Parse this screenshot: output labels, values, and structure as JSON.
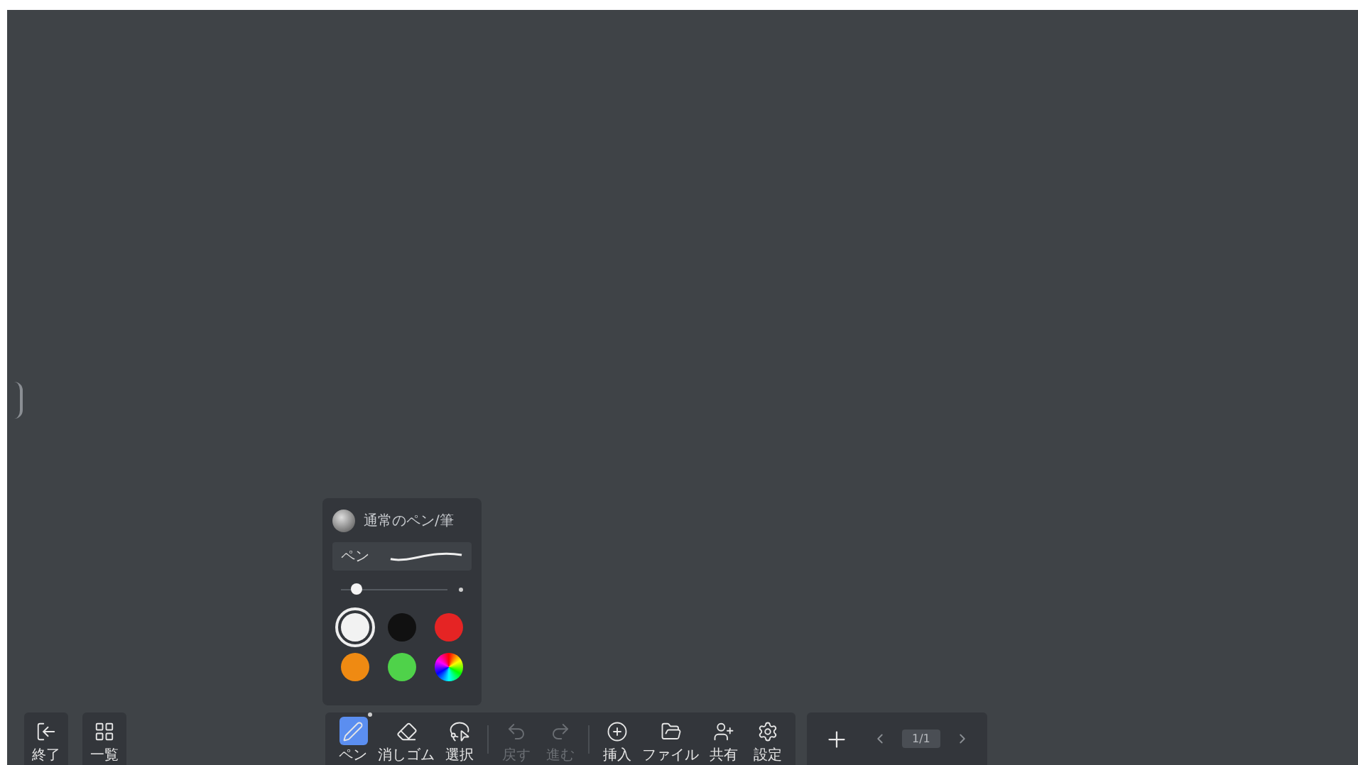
{
  "pen_panel": {
    "title": "通常のペン/筆",
    "pen_type": "ペン",
    "size": {
      "level": 0.15
    },
    "colors": [
      {
        "kind": "solid",
        "color": "#f2f2f2",
        "selected": true
      },
      {
        "kind": "solid",
        "color": "#111111",
        "selected": false
      },
      {
        "kind": "solid",
        "color": "#e52424",
        "selected": false
      },
      {
        "kind": "solid",
        "color": "#ef8a12",
        "selected": false
      },
      {
        "kind": "solid",
        "color": "#4fd24a",
        "selected": false
      },
      {
        "kind": "spectrum",
        "selected": false
      }
    ]
  },
  "left_buttons": [
    {
      "kind": "exit",
      "label": "終了"
    },
    {
      "kind": "overview",
      "label": "一覧"
    }
  ],
  "toolbar": [
    {
      "kind": "pen",
      "label": "ペン",
      "selected": true,
      "disabled": false
    },
    {
      "kind": "eraser",
      "label": "消しゴム",
      "selected": false,
      "disabled": false
    },
    {
      "kind": "select",
      "label": "選択",
      "selected": false,
      "disabled": false
    },
    {
      "kind": "undo",
      "label": "戻す",
      "selected": false,
      "disabled": true
    },
    {
      "kind": "redo",
      "label": "進む",
      "selected": false,
      "disabled": true
    },
    {
      "kind": "insert",
      "label": "挿入",
      "selected": false,
      "disabled": false
    },
    {
      "kind": "file",
      "label": "ファイル",
      "selected": false,
      "disabled": false
    },
    {
      "kind": "share",
      "label": "共有",
      "selected": false,
      "disabled": false
    },
    {
      "kind": "settings",
      "label": "設定",
      "selected": false,
      "disabled": false
    }
  ],
  "pages": {
    "indicator": "1/1"
  }
}
